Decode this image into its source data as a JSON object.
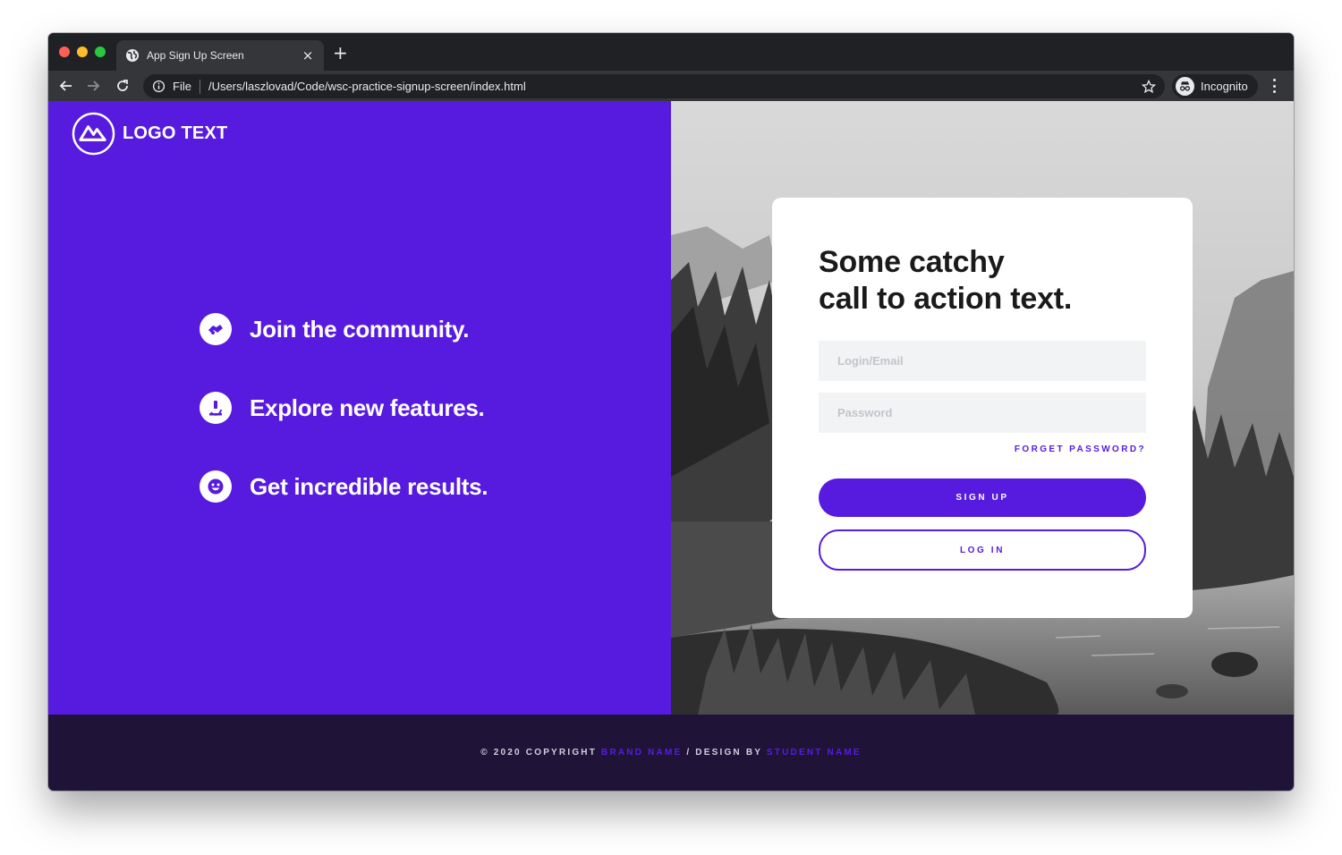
{
  "browser": {
    "tab_title": "App Sign Up Screen",
    "tab_close": "×",
    "new_tab": "+",
    "scheme_label": "File",
    "url": "/Users/laszlovad/Code/wsc-practice-signup-screen/index.html",
    "incognito_label": "Incognito"
  },
  "left": {
    "logo_text": "LOGO TEXT",
    "features": [
      {
        "icon": "handshake-icon",
        "text": "Join the community."
      },
      {
        "icon": "microscope-icon",
        "text": "Explore new features."
      },
      {
        "icon": "smiley-icon",
        "text": "Get incredible results."
      }
    ]
  },
  "card": {
    "headline_line1": "Some catchy",
    "headline_line2": "call to action text.",
    "login_placeholder": "Login/Email",
    "password_placeholder": "Password",
    "forgot_label": "FORGET PASSWORD?",
    "signup_label": "SIGN UP",
    "login_label": "LOG IN"
  },
  "footer": {
    "copyright": "© 2020 COPYRIGHT ",
    "brand": "BRAND NAME",
    "design_by": " / DESIGN BY ",
    "student": "STUDENT NAME"
  },
  "colors": {
    "accent": "#571be0",
    "footer_bg": "#1f1438",
    "browser_chrome": "#202124"
  }
}
